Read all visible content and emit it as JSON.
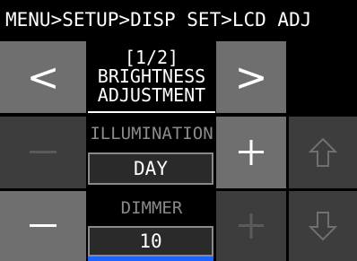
{
  "header": {
    "breadcrumb": "MENU>SETUP>DISP SET>LCD ADJ"
  },
  "page": {
    "indicator": "[1/2]",
    "title_line1": "BRIGHTNESS",
    "title_line2": "ADJUSTMENT"
  },
  "illumination": {
    "label": "ILLUMINATION",
    "value": "DAY"
  },
  "dimmer": {
    "label": "DIMMER",
    "value": "10"
  },
  "buttons": {
    "prev_glyph": "<",
    "next_glyph": ">"
  },
  "colors": {
    "button": "#6f6f6f",
    "button_disabled": "#3d3d3d",
    "accent": "#1f63ff"
  }
}
